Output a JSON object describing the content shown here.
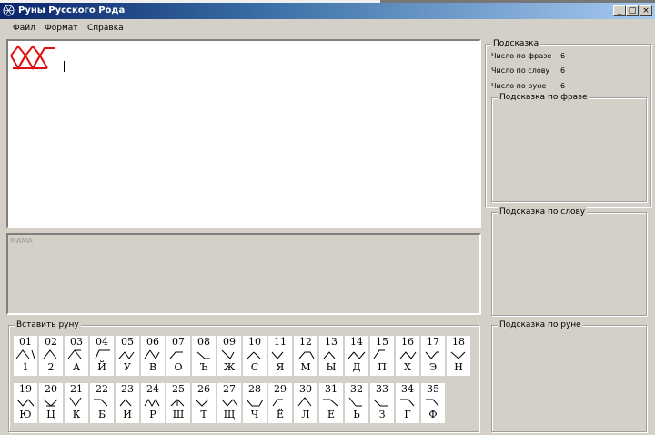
{
  "window": {
    "title": "Руны Русского Рода"
  },
  "titlebar_buttons": {
    "minimize": "_",
    "maximize": "□",
    "close": "×"
  },
  "menu": {
    "file": "Файл",
    "format": "Формат",
    "help": "Справка"
  },
  "result_text": "МАМА",
  "hint": {
    "title": "Подсказка",
    "phrase_number_label": "Число по фразе",
    "phrase_number_value": "6",
    "word_number_label": "Число по слову",
    "word_number_value": "6",
    "rune_number_label": "Число по руне",
    "rune_number_value": "6",
    "phrase_hint_title": "Подсказка по фразе",
    "word_hint_title": "Подсказка по слову",
    "rune_hint_title": "Подсказка по руне"
  },
  "insert_rune": {
    "title": "Вставить руну",
    "runes": [
      {
        "num": "01",
        "letter": "1"
      },
      {
        "num": "02",
        "letter": "2"
      },
      {
        "num": "03",
        "letter": "А"
      },
      {
        "num": "04",
        "letter": "Й"
      },
      {
        "num": "05",
        "letter": "У"
      },
      {
        "num": "06",
        "letter": "В"
      },
      {
        "num": "07",
        "letter": "О"
      },
      {
        "num": "08",
        "letter": "Ъ"
      },
      {
        "num": "09",
        "letter": "Ж"
      },
      {
        "num": "10",
        "letter": "С"
      },
      {
        "num": "11",
        "letter": "Я"
      },
      {
        "num": "12",
        "letter": "М"
      },
      {
        "num": "13",
        "letter": "Ы"
      },
      {
        "num": "14",
        "letter": "Д"
      },
      {
        "num": "15",
        "letter": "П"
      },
      {
        "num": "16",
        "letter": "Х"
      },
      {
        "num": "17",
        "letter": "Э"
      },
      {
        "num": "18",
        "letter": "Н"
      },
      {
        "num": "19",
        "letter": "Ю"
      },
      {
        "num": "20",
        "letter": "Ц"
      },
      {
        "num": "21",
        "letter": "К"
      },
      {
        "num": "22",
        "letter": "Б"
      },
      {
        "num": "23",
        "letter": "И"
      },
      {
        "num": "24",
        "letter": "Р"
      },
      {
        "num": "25",
        "letter": "Ш"
      },
      {
        "num": "26",
        "letter": "Т"
      },
      {
        "num": "27",
        "letter": "Щ"
      },
      {
        "num": "28",
        "letter": "Ч"
      },
      {
        "num": "29",
        "letter": "Ё"
      },
      {
        "num": "30",
        "letter": "Л"
      },
      {
        "num": "31",
        "letter": "Е"
      },
      {
        "num": "32",
        "letter": "Ь"
      },
      {
        "num": "33",
        "letter": "З"
      },
      {
        "num": "34",
        "letter": "Г"
      },
      {
        "num": "35",
        "letter": "Ф"
      }
    ]
  },
  "colors": {
    "rune_drawing": "#e01010",
    "titlebar_start": "#0a246a",
    "window_bg": "#d4d0c8"
  }
}
